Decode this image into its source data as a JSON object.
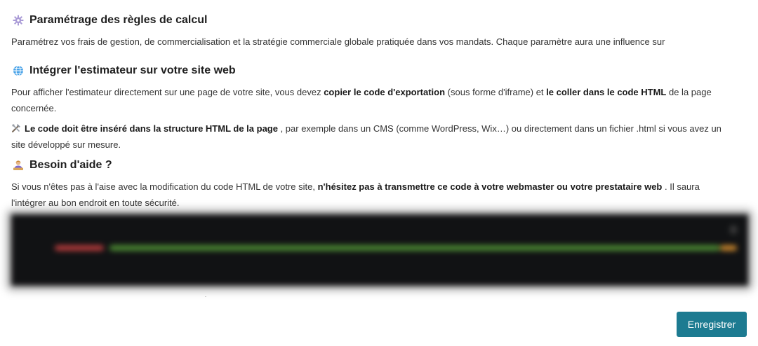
{
  "sections": {
    "calcul": {
      "title": "Paramétrage des règles de calcul",
      "icon": "gear-icon",
      "text": "Paramétrez vos frais de gestion, de commercialisation et la stratégie commerciale globale pratiquée dans vos mandats. Chaque paramètre aura une influence sur"
    },
    "integrer": {
      "title": "Intégrer l'estimateur sur votre site web",
      "icon": "globe-icon",
      "p1_a": "Pour afficher l'estimateur directement sur une page de votre site, vous devez ",
      "p1_b": "copier le code d'exportation",
      "p1_c": " (sous forme d'iframe) et ",
      "p1_d": "le coller dans le code HTML",
      "p1_e": " de la page concernée.",
      "p2_icon": "tools-icon",
      "p2_b": "Le code doit être inséré dans la structure HTML de la page",
      "p2_c": " , par exemple dans un CMS (comme WordPress, Wix…) ou directement dans un fichier .html si vous avez un site développé sur mesure."
    },
    "aide": {
      "title": "Besoin d'aide ?",
      "icon": "person-icon",
      "p_a": "Si vous n'êtes pas à l'aise avec la modification du code HTML de votre site, ",
      "p_b": "n'hésitez pas à transmettre ce code à votre webmaster ou votre prestataire web",
      "p_c": " . Il saura l'intégrer au bon endroit en toute sécurité."
    }
  },
  "actions": {
    "save_label": "Enregistrer"
  },
  "colors": {
    "button": "#1d7b91",
    "code_bg": "#111214"
  }
}
